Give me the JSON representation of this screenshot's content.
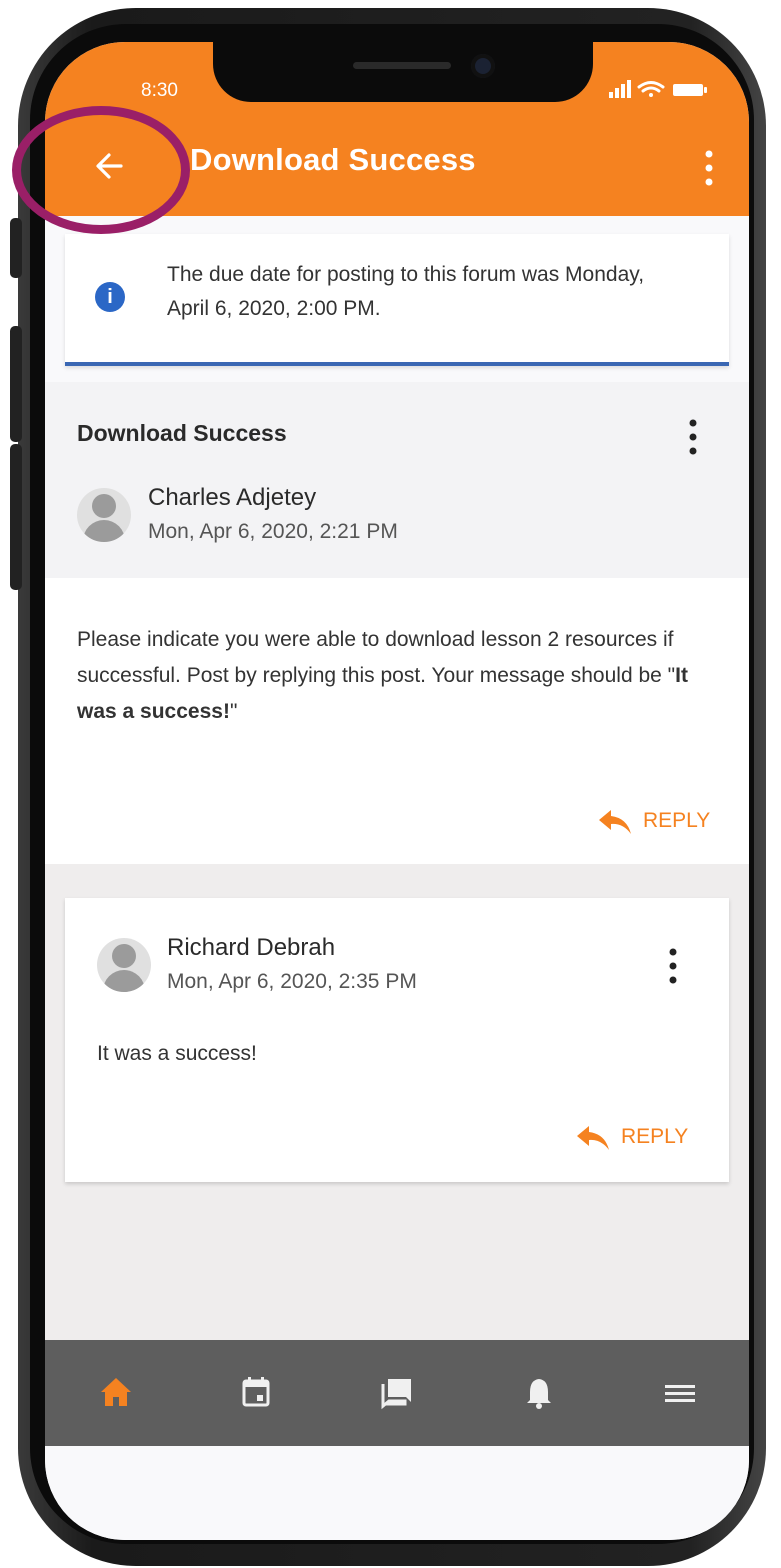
{
  "status_bar": {
    "time": "8:30"
  },
  "app_bar": {
    "title": "Download Success"
  },
  "notice": {
    "text": "The due date for posting to this forum was Monday, April 6, 2020, 2:00 PM."
  },
  "post": {
    "title": "Download Success",
    "author": "Charles Adjetey",
    "date": "Mon, Apr 6, 2020, 2:21 PM",
    "message_part1": "Please indicate you were able to download lesson 2 resources if successful. Post by replying this post. Your message should be \"",
    "message_bold": "It was a success!",
    "message_part2": "\"",
    "reply_label": "REPLY"
  },
  "reply": {
    "author": "Richard Debrah",
    "date": "Mon, Apr 6, 2020, 2:35 PM",
    "message": "It was a success!",
    "reply_label": "REPLY"
  },
  "bottom_nav": {
    "items": [
      {
        "icon": "home-icon",
        "active": true
      },
      {
        "icon": "calendar-icon",
        "active": false
      },
      {
        "icon": "messages-icon",
        "active": false
      },
      {
        "icon": "notifications-bell-icon",
        "active": false
      },
      {
        "icon": "menu-icon",
        "active": false
      }
    ]
  },
  "colors": {
    "accent": "#f58220",
    "info_blue": "#2b67c6",
    "annotation_ring": "#9a1f67",
    "nav_bg": "#5e5e5e"
  }
}
